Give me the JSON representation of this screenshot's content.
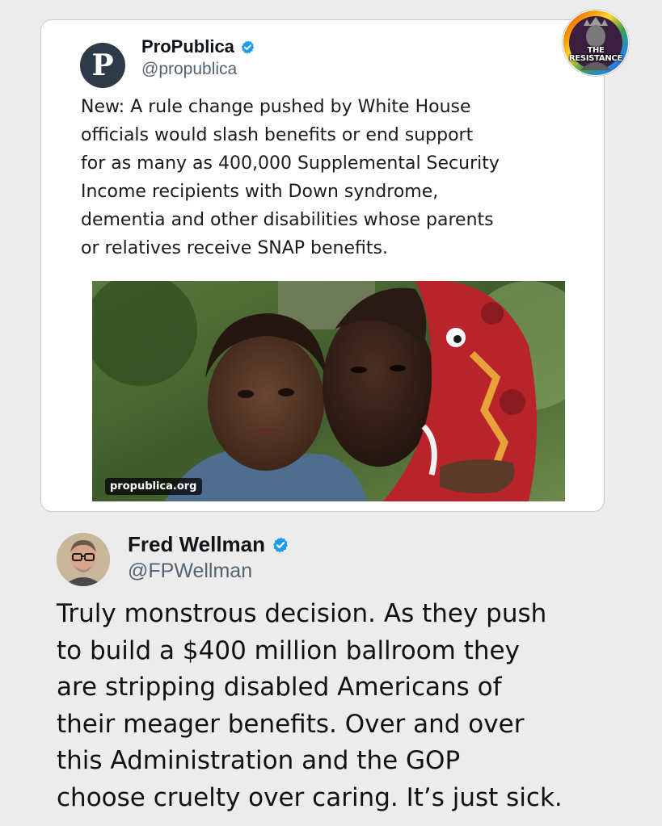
{
  "quoted_post": {
    "name": "ProPublica",
    "handle": "@propublica",
    "avatar_letter": "P",
    "verified_icon": "verified-badge-icon",
    "text_lines": [
      "New: A rule change pushed by White House",
      "officials would slash benefits or end support",
      "for as many as 400,000 Supplemental Security",
      "Income recipients with Down syndrome,",
      "dementia and other disabilities whose parents",
      "or relatives receive SNAP benefits."
    ],
    "media": {
      "domain": "propublica.org"
    }
  },
  "badge": {
    "line1": "THE",
    "line2": "RESISTANCE"
  },
  "post": {
    "name": "Fred Wellman",
    "handle": "@FPWellman",
    "verified_icon": "verified-badge-icon",
    "text_lines": [
      "Truly monstrous decision. As they push",
      "to build a $400 million ballroom they",
      "are stripping disabled Americans of",
      "their meager benefits. Over and over",
      "this Administration and the GOP",
      "choose cruelty over caring. It’s just sick."
    ]
  },
  "colors": {
    "background": "#ececec",
    "card": "#ffffff",
    "verified": "#1d9bf0",
    "handle": "#536471"
  }
}
